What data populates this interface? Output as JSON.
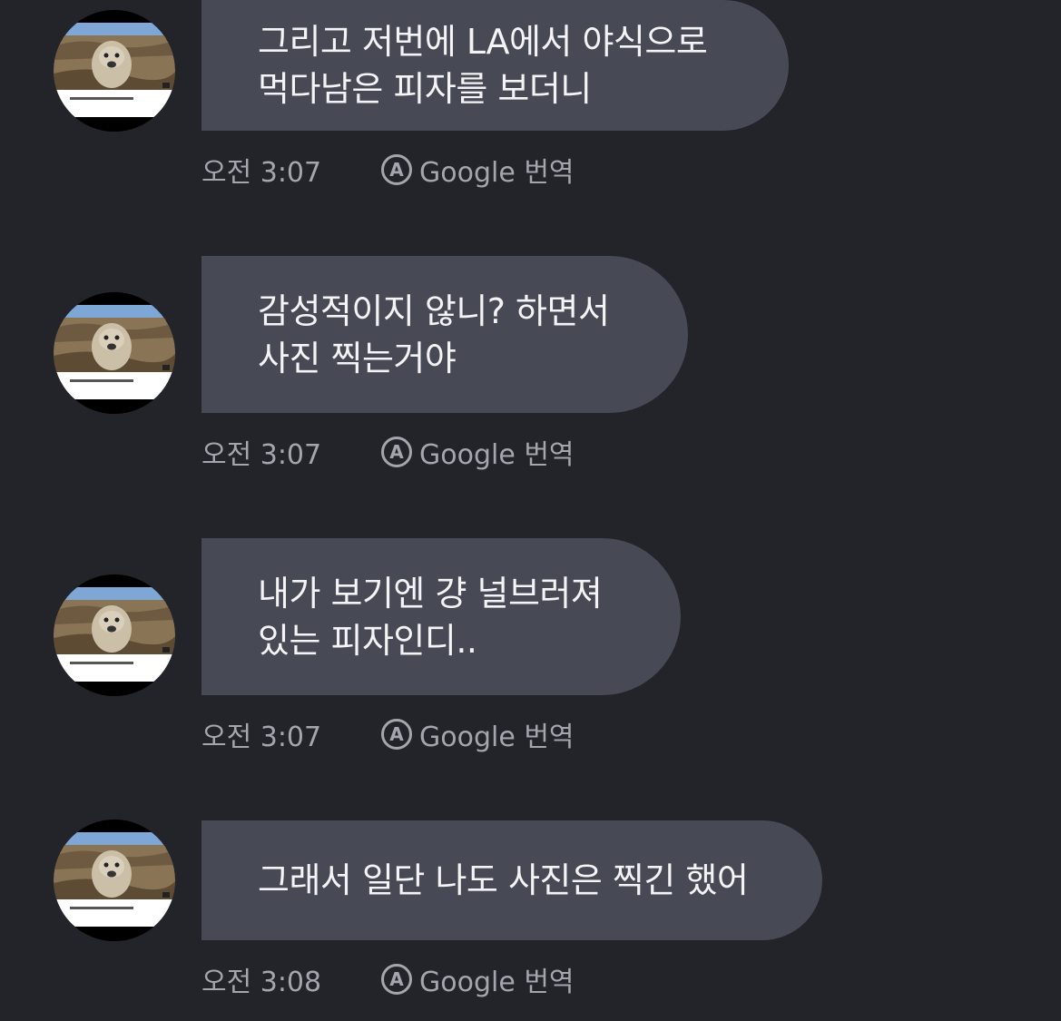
{
  "messages": [
    {
      "lines": [
        "그리고 저번에 LA에서 야식으로",
        "먹다남은 피자를 보더니"
      ],
      "time": "오전 3:07",
      "translate": "Google 번역",
      "translate_icon": "A"
    },
    {
      "lines": [
        "감성적이지 않니? 하면서",
        "사진 찍는거야"
      ],
      "time": "오전 3:07",
      "translate": "Google 번역",
      "translate_icon": "A"
    },
    {
      "lines": [
        "내가 보기엔 걍 널브러져",
        "있는 피자인디.."
      ],
      "time": "오전 3:07",
      "translate": "Google 번역",
      "translate_icon": "A"
    },
    {
      "lines": [
        "그래서 일단 나도 사진은 찍긴 했어"
      ],
      "time": "오전 3:08",
      "translate": "Google 번역",
      "translate_icon": "A"
    }
  ]
}
